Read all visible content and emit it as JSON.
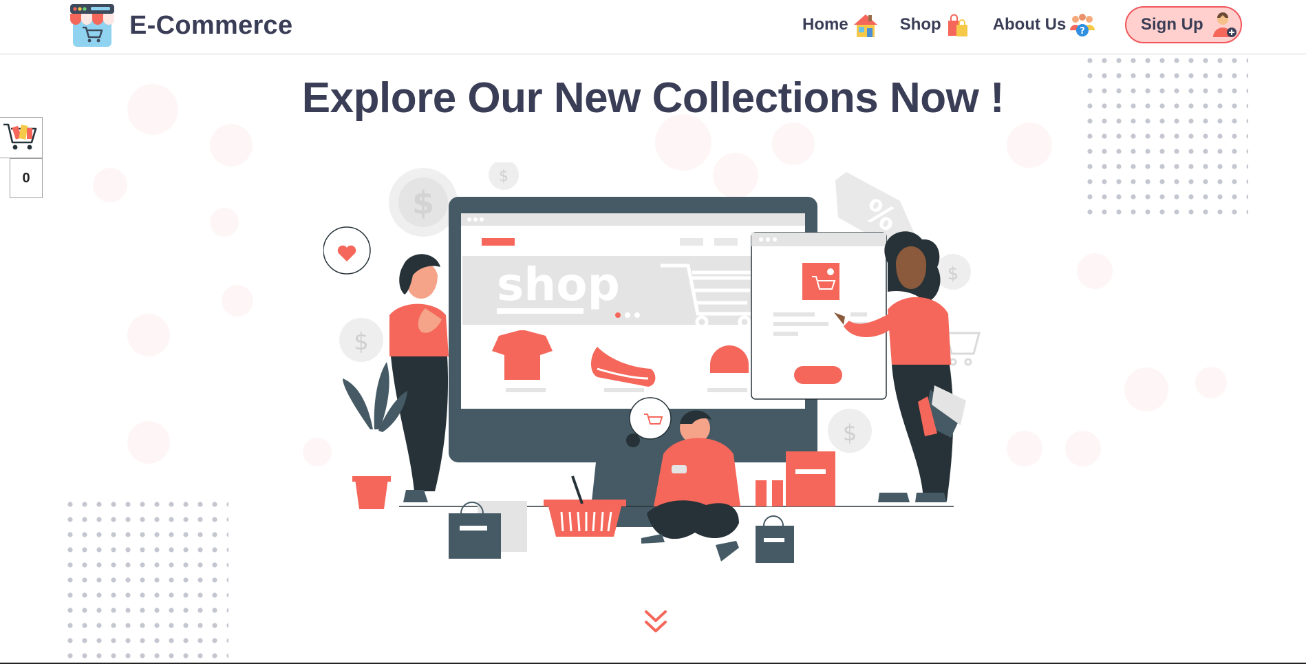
{
  "brand": {
    "title": "E-Commerce",
    "logo_icon": "storefront-cart-icon"
  },
  "nav": {
    "items": [
      {
        "label": "Home",
        "icon": "house-icon"
      },
      {
        "label": "Shop",
        "icon": "shopping-bags-icon"
      },
      {
        "label": "About Us",
        "icon": "people-question-icon"
      }
    ],
    "signup_label": "Sign Up",
    "signup_icon": "user-add-icon"
  },
  "hero": {
    "title": "Explore Our New Collections Now !",
    "screen_word": "shop",
    "scroll_icon": "double-chevron-down-icon"
  },
  "side_cart": {
    "icon": "shopping-cart-icon",
    "count": "0"
  },
  "colors": {
    "accent": "#f5675a",
    "text": "#3a3d56",
    "signup_bg": "#ffd0cd",
    "signup_border": "#f0555a",
    "dark": "#263238"
  }
}
